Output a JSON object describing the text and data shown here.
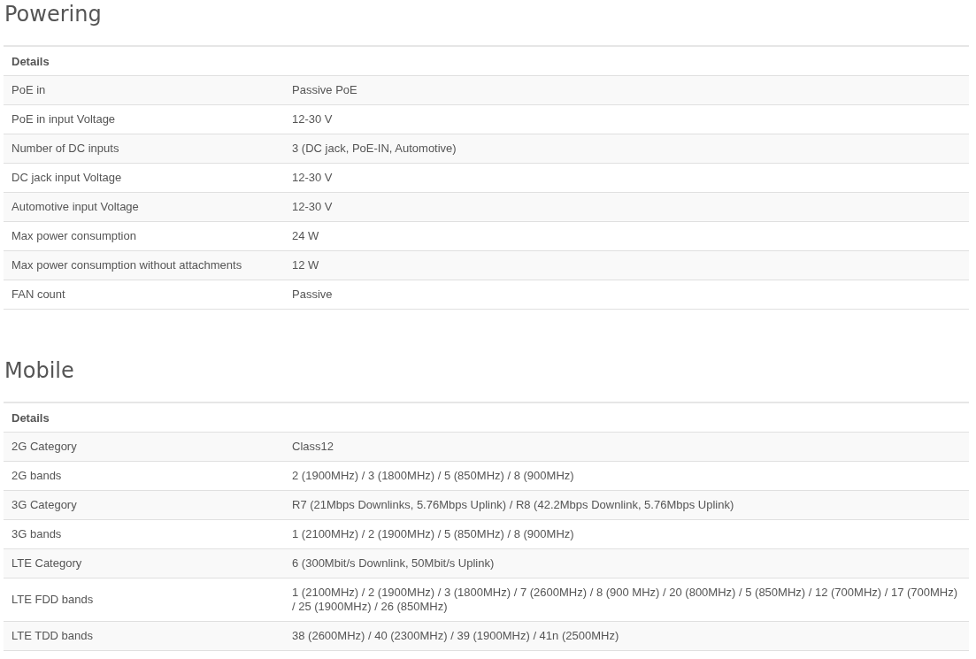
{
  "sections": [
    {
      "title": "Powering",
      "header": "Details",
      "rows": [
        {
          "label": "PoE in",
          "value": "Passive PoE"
        },
        {
          "label": "PoE in input Voltage",
          "value": "12-30 V"
        },
        {
          "label": "Number of DC inputs",
          "value": "3 (DC jack, PoE-IN, Automotive)"
        },
        {
          "label": "DC jack input Voltage",
          "value": "12-30 V"
        },
        {
          "label": "Automotive input Voltage",
          "value": "12-30 V"
        },
        {
          "label": "Max power consumption",
          "value": "24 W"
        },
        {
          "label": "Max power consumption without attachments",
          "value": "12 W"
        },
        {
          "label": "FAN count",
          "value": "Passive"
        }
      ]
    },
    {
      "title": "Mobile",
      "header": "Details",
      "rows": [
        {
          "label": "2G Category",
          "value": "Class12"
        },
        {
          "label": "2G bands",
          "value": "2 (1900MHz) / 3 (1800MHz) / 5 (850MHz) / 8 (900MHz)"
        },
        {
          "label": "3G Category",
          "value": "R7 (21Mbps Downlinks, 5.76Mbps Uplink) / R8 (42.2Mbps Downlink, 5.76Mbps Uplink)"
        },
        {
          "label": "3G bands",
          "value": "1 (2100MHz) / 2 (1900MHz) / 5 (850MHz) / 8 (900MHz)"
        },
        {
          "label": "LTE Category",
          "value": "6 (300Mbit/s Downlink, 50Mbit/s Uplink)"
        },
        {
          "label": "LTE FDD bands",
          "value": "1 (2100MHz) / 2 (1900MHz) / 3 (1800MHz) / 7 (2600MHz) / 8 (900 MHz) / 20 (800MHz) / 5 (850MHz) / 12 (700MHz) / 17 (700MHz) / 25 (1900MHz) / 26 (850MHz)"
        },
        {
          "label": "LTE TDD bands",
          "value": "38 (2600MHz) / 40 (2300MHz) / 39 (1900MHz) / 41n (2500MHz)"
        }
      ]
    }
  ]
}
